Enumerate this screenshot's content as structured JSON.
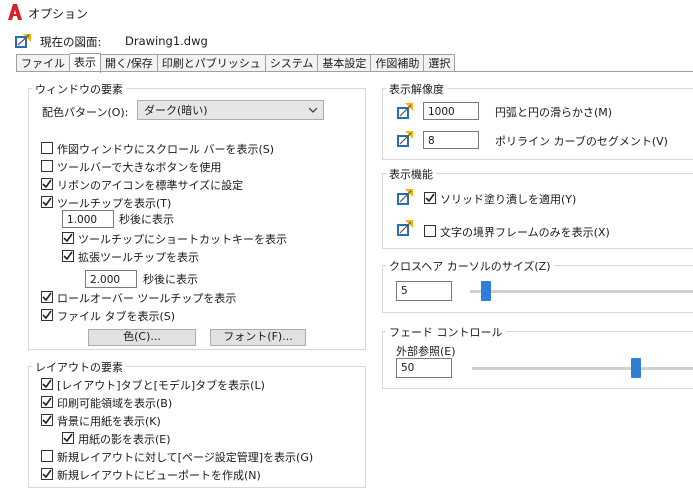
{
  "window": {
    "title": "オプション"
  },
  "current": {
    "label": "現在の図面:",
    "value": "Drawing1.dwg"
  },
  "tabs": [
    {
      "label": "ファイル"
    },
    {
      "label": "表示"
    },
    {
      "label": "開く/保存"
    },
    {
      "label": "印刷とパブリッシュ"
    },
    {
      "label": "システム"
    },
    {
      "label": "基本設定"
    },
    {
      "label": "作図補助"
    },
    {
      "label": "選択"
    }
  ],
  "window_elements": {
    "title": "ウィンドウの要素",
    "color_scheme_label": "配色パターン(O):",
    "color_scheme_value": "ダーク(暗い)",
    "opt_scrollbars": "作図ウィンドウにスクロール バーを表示(S)",
    "opt_large_buttons": "ツールバーで大きなボタンを使用",
    "opt_ribbon_icons": "リボンのアイコンを標準サイズに設定",
    "opt_tooltips": "ツールチップを表示(T)",
    "tooltip_delay": "1.000",
    "tooltip_delay_suffix": "秒後に表示",
    "opt_shortcut_keys": "ツールチップにショートカットキーを表示",
    "opt_extended_tooltips": "拡張ツールチップを表示",
    "extended_delay": "2.000",
    "extended_delay_suffix": "秒後に表示",
    "opt_rollover": "ロールオーバー ツールチップを表示",
    "opt_file_tabs": "ファイル タブを表示(S)",
    "btn_colors": "色(C)...",
    "btn_fonts": "フォント(F)..."
  },
  "layout_elements": {
    "title": "レイアウトの要素",
    "opt_layout_tabs": "[レイアウト]タブと[モデル]タブを表示(L)",
    "opt_printable_area": "印刷可能領域を表示(B)",
    "opt_paper_background": "背景に用紙を表示(K)",
    "opt_paper_shadow": "用紙の影を表示(E)",
    "opt_page_setup": "新規レイアウトに対して[ページ設定管理]を表示(G)",
    "opt_viewport": "新規レイアウトにビューポートを作成(N)"
  },
  "display_resolution": {
    "title": "表示解像度",
    "arc_value": "1000",
    "arc_label": "円弧と円の滑らかさ(M)",
    "pline_value": "8",
    "pline_label": "ポリライン カーブのセグメント(V)"
  },
  "display_performance": {
    "title": "表示機能",
    "opt_solid_fill": "ソリッド塗り潰しを適用(Y)",
    "opt_text_boundary": "文字の境界フレームのみを表示(X)"
  },
  "crosshair": {
    "title": "クロスヘア カーソルのサイズ(Z)",
    "value": "5",
    "slider_fraction": 0.05
  },
  "fade": {
    "title": "フェード コントロール",
    "xref_label": "外部参照(E)",
    "xref_value": "50",
    "slider_fraction": 0.74
  },
  "colors": {
    "accent": "#2f7fd8",
    "logo": "#d8222a"
  }
}
